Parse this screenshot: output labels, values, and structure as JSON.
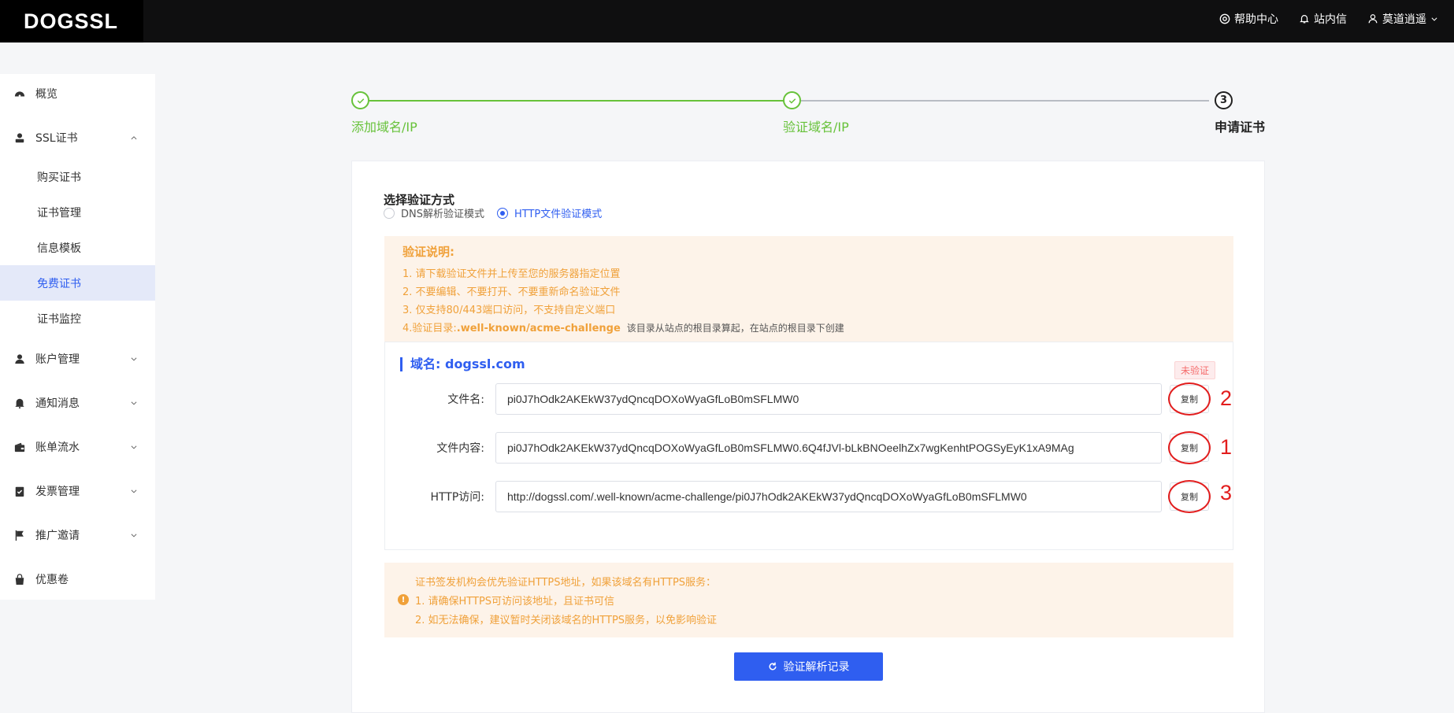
{
  "header": {
    "logo": "DOGSSL",
    "help": "帮助中心",
    "messages": "站内信",
    "user": "莫道逍遥"
  },
  "sidebar": {
    "items": [
      {
        "label": "概览",
        "icon": "dashboard-icon"
      },
      {
        "label": "SSL证书",
        "icon": "user-cert-icon",
        "expanded": true,
        "children": [
          "购买证书",
          "证书管理",
          "信息模板",
          "免费证书",
          "证书监控"
        ],
        "active_child": "免费证书"
      },
      {
        "label": "账户管理",
        "icon": "user-icon"
      },
      {
        "label": "通知消息",
        "icon": "bell-icon"
      },
      {
        "label": "账单流水",
        "icon": "wallet-icon"
      },
      {
        "label": "发票管理",
        "icon": "clipboard-check-icon"
      },
      {
        "label": "推广邀请",
        "icon": "flag-icon"
      },
      {
        "label": "优惠卷",
        "icon": "bag-icon"
      }
    ]
  },
  "steps": [
    {
      "label": "添加域名/IP",
      "status": "done"
    },
    {
      "label": "验证域名/IP",
      "status": "done"
    },
    {
      "label": "申请证书",
      "status": "current",
      "number": "3"
    }
  ],
  "verify": {
    "section_title": "选择验证方式",
    "options": [
      {
        "label": "DNS解析验证模式",
        "checked": false
      },
      {
        "label": "HTTP文件验证模式",
        "checked": true
      }
    ],
    "notice": {
      "title": "验证说明:",
      "lines": [
        "1. 请下载验证文件并上传至您的服务器指定位置",
        "2. 不要编辑、不要打开、不要重新命名验证文件",
        "3. 仅支持80/443端口访问，不支持自定义端口"
      ],
      "line4_prefix": "4.验证目录:",
      "line4_path": ".well-known/acme-challenge",
      "line4_hint": "该目录从站点的根目录算起，在站点的根目录下创建"
    },
    "domain_label": "域名:",
    "domain": "dogssl.com",
    "status_badge": "未验证",
    "fields": [
      {
        "label": "文件名:",
        "value": "pi0J7hOdk2AKEkW37ydQncqDOXoWyaGfLoB0mSFLMW0",
        "copy": "复制",
        "annotation": "2"
      },
      {
        "label": "文件内容:",
        "value": "pi0J7hOdk2AKEkW37ydQncqDOXoWyaGfLoB0mSFLMW0.6Q4fJVl-bLkBNOeelhZx7wgKenhtPOGSyEyK1xA9MAg",
        "copy": "复制",
        "annotation": "1"
      },
      {
        "label": "HTTP访问:",
        "value": "http://dogssl.com/.well-known/acme-challenge/pi0J7hOdk2AKEkW37ydQncqDOXoWyaGfLoB0mSFLMW0",
        "copy": "复制",
        "annotation": "3"
      }
    ],
    "warning": [
      "证书签发机构会优先验证HTTPS地址，如果该域名有HTTPS服务：",
      "1. 请确保HTTPS可访问该地址，且证书可信",
      "2. 如无法确保，建议暂时关闭该域名的HTTPS服务，以免影响验证"
    ],
    "warning_icon": "!",
    "submit": "验证解析记录"
  },
  "colors": {
    "primary": "#2f5ef0",
    "success": "#67c23a",
    "warning": "#f0a13a",
    "danger": "#e21d1d"
  }
}
